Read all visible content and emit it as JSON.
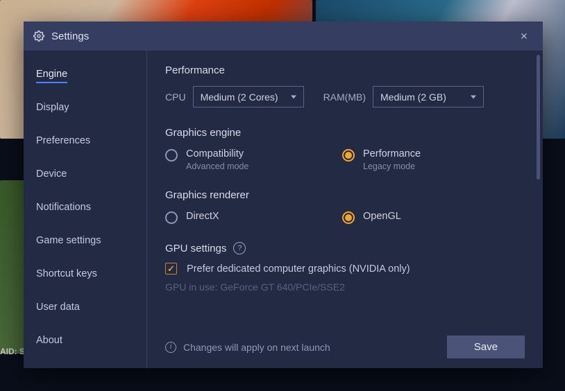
{
  "modal": {
    "title": "Settings"
  },
  "sidebar": {
    "items": [
      {
        "label": "Engine",
        "active": true
      },
      {
        "label": "Display"
      },
      {
        "label": "Preferences"
      },
      {
        "label": "Device"
      },
      {
        "label": "Notifications"
      },
      {
        "label": "Game settings"
      },
      {
        "label": "Shortcut keys"
      },
      {
        "label": "User data"
      },
      {
        "label": "About"
      }
    ]
  },
  "performance": {
    "title": "Performance",
    "cpu_label": "CPU",
    "cpu_value": "Medium (2 Cores)",
    "ram_label": "RAM(MB)",
    "ram_value": "Medium (2 GB)"
  },
  "graphics_engine": {
    "title": "Graphics engine",
    "options": [
      {
        "label": "Compatibility",
        "sub": "Advanced mode",
        "selected": false
      },
      {
        "label": "Performance",
        "sub": "Legacy mode",
        "selected": true
      }
    ]
  },
  "graphics_renderer": {
    "title": "Graphics renderer",
    "options": [
      {
        "label": "DirectX",
        "selected": false
      },
      {
        "label": "OpenGL",
        "selected": true
      }
    ]
  },
  "gpu": {
    "title": "GPU settings",
    "prefer_label": "Prefer dedicated computer graphics (NVIDIA only)",
    "prefer_checked": true,
    "in_use": "GPU in use: GeForce GT 640/PCIe/SSE2"
  },
  "footer": {
    "info": "Changes will apply on next launch",
    "save": "Save"
  },
  "bg": {
    "caption": "AID: S"
  }
}
